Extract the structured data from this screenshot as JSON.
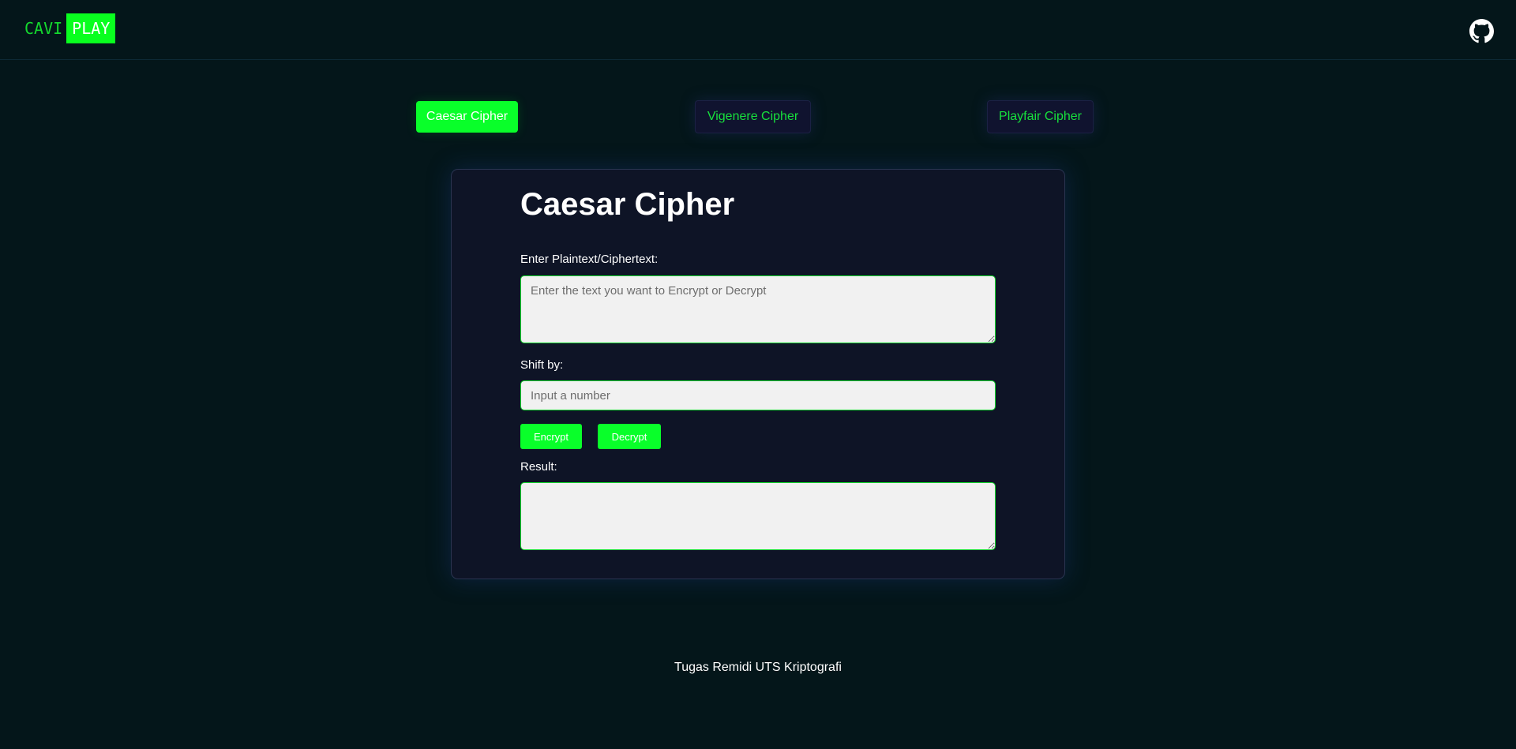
{
  "logo": {
    "part1": "CAVI",
    "part2": "PLAY"
  },
  "header": {
    "github_icon": "github-icon"
  },
  "tabs": [
    {
      "label": "Caesar Cipher",
      "active": true
    },
    {
      "label": "Vigenere Cipher",
      "active": false
    },
    {
      "label": "Playfair Cipher",
      "active": false
    }
  ],
  "card": {
    "title": "Caesar Cipher",
    "text_label": "Enter Plaintext/Ciphertext:",
    "text_placeholder": "Enter the text you want to Encrypt or Decrypt",
    "text_value": "",
    "shift_label": "Shift by:",
    "shift_placeholder": "Input a number",
    "shift_value": "",
    "encrypt_label": "Encrypt",
    "decrypt_label": "Decrypt",
    "result_label": "Result:",
    "result_value": ""
  },
  "footer": {
    "text": "Tugas Remidi UTS Kriptografi"
  },
  "colors": {
    "background": "#04161a",
    "accent_green": "#09ff2a",
    "text_green": "#14d92e",
    "card_bg": "#0e1426",
    "inactive_tab_bg": "#10132f"
  }
}
